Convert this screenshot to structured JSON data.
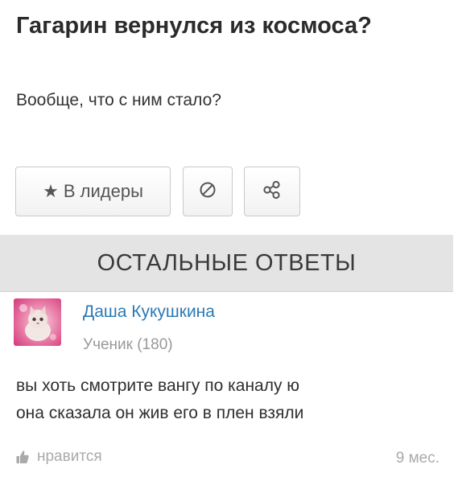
{
  "question": {
    "title": "Гагарин вернулся из космоса?",
    "body": "Вообще, что с ним стало?"
  },
  "actions": {
    "leaders_label": "В лидеры",
    "leaders_icon": "star-icon",
    "block_icon": "block-icon",
    "share_icon": "share-icon"
  },
  "section": {
    "header": "ОСТАЛЬНЫЕ ОТВЕТЫ"
  },
  "answer": {
    "author": "Даша Кукушкина",
    "rank": "Ученик (180)",
    "text_line1": "вы хоть смотрите вангу по каналу ю",
    "text_line2": "она сказала он жив его в плен взяли",
    "like_label": "нравится",
    "time": "9 мес."
  },
  "colors": {
    "author_link": "#2a79b5",
    "header_bg": "#e4e4e4",
    "muted": "#aaaaaa"
  }
}
